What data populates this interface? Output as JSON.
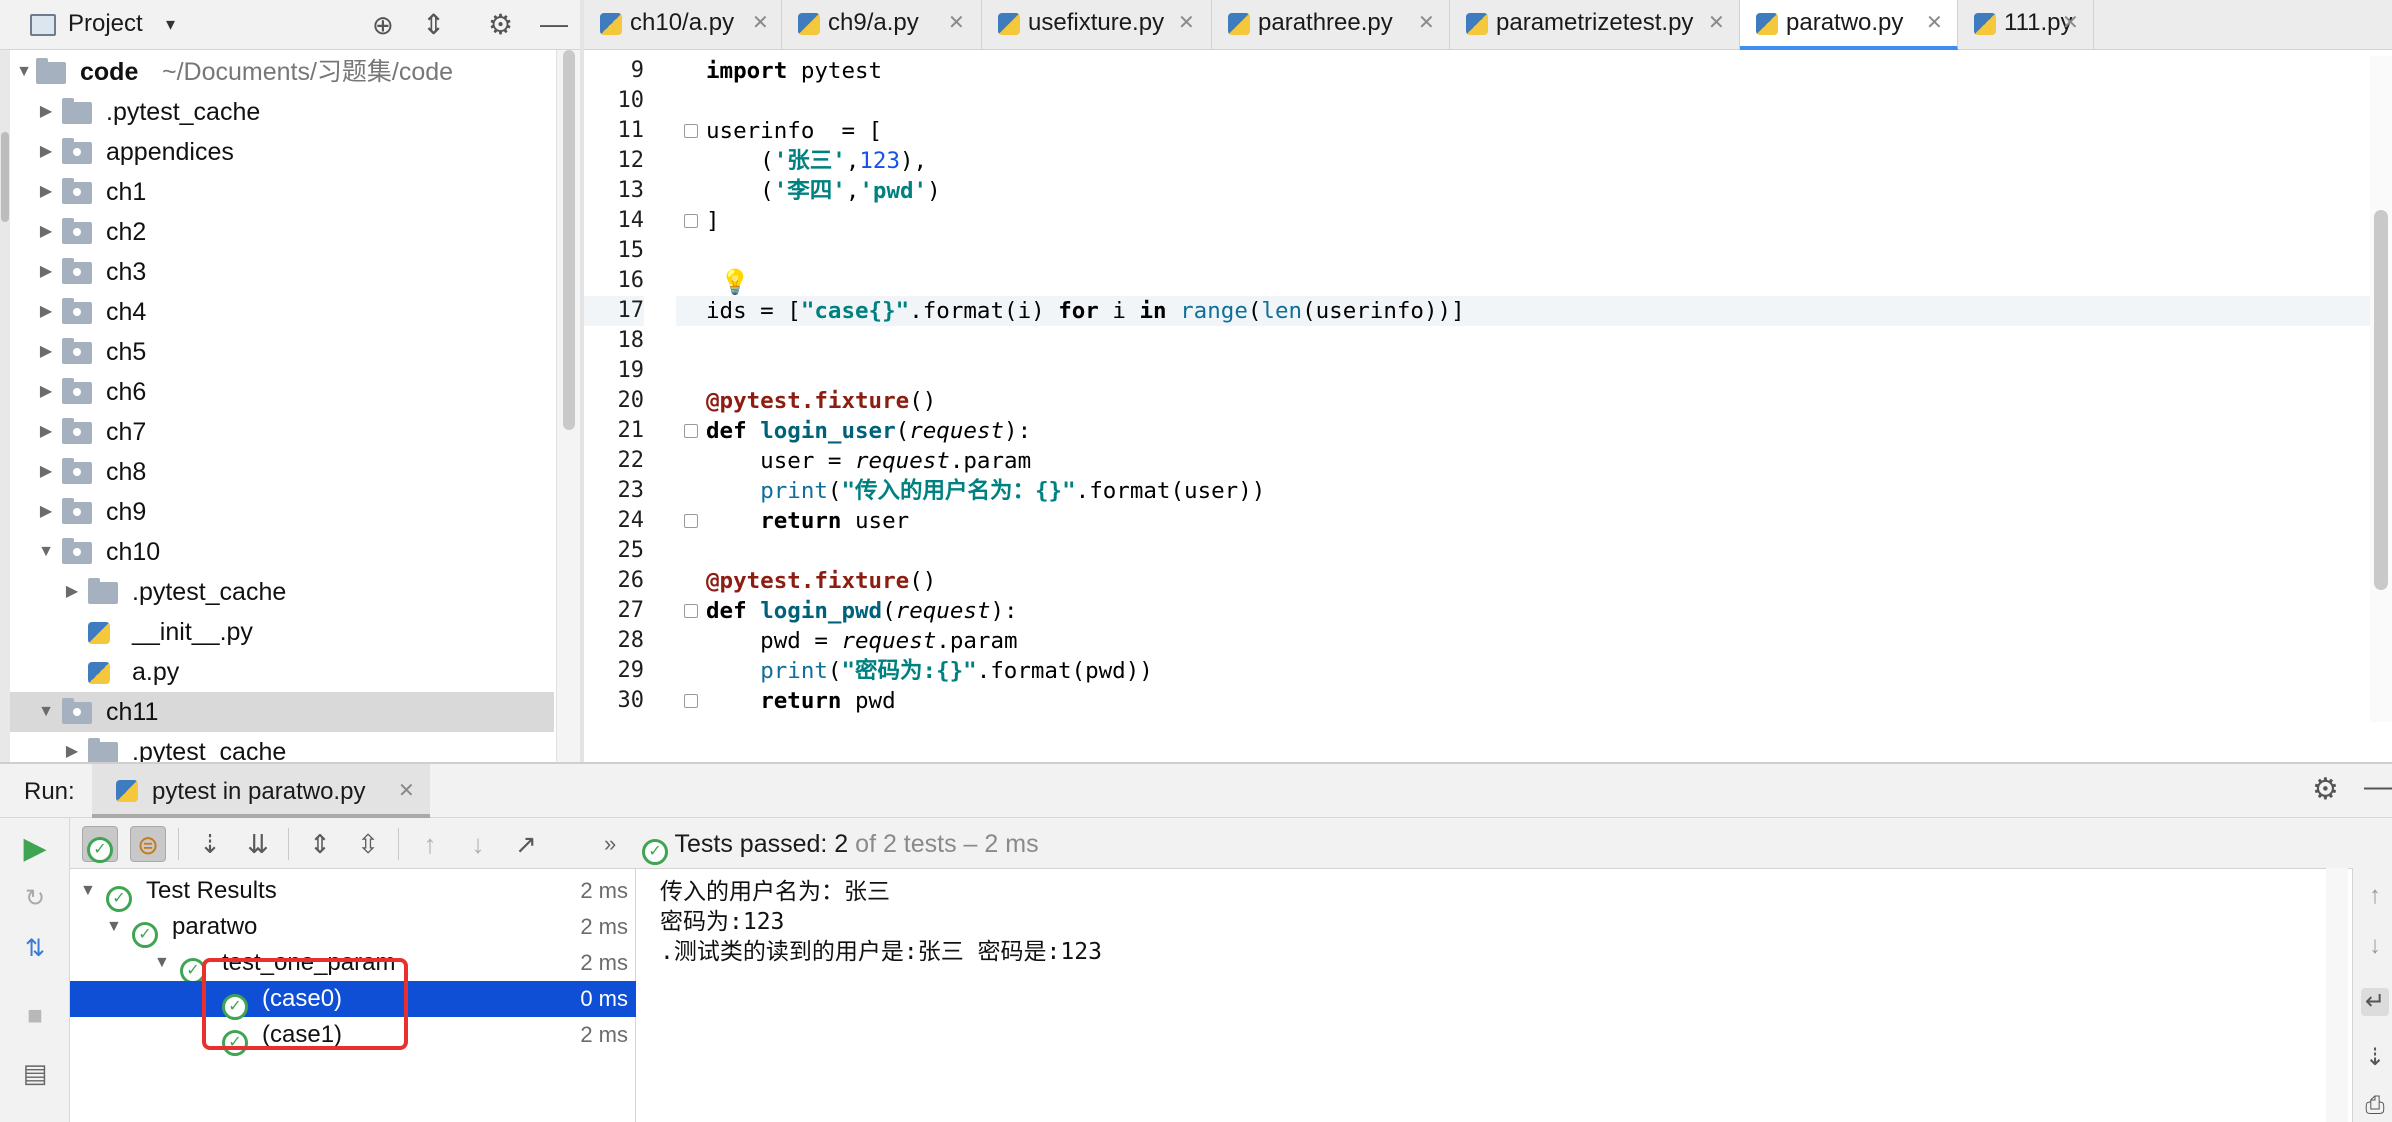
{
  "project": {
    "title": "Project",
    "root": {
      "name": "code",
      "path": "~/Documents/习题集/code"
    },
    "items": [
      {
        "label": ".pytest_cache",
        "type": "folder",
        "depth": 1,
        "expanded": false
      },
      {
        "label": "appendices",
        "type": "package",
        "depth": 1,
        "expanded": false
      },
      {
        "label": "ch1",
        "type": "package",
        "depth": 1,
        "expanded": false
      },
      {
        "label": "ch2",
        "type": "package",
        "depth": 1,
        "expanded": false
      },
      {
        "label": "ch3",
        "type": "package",
        "depth": 1,
        "expanded": false
      },
      {
        "label": "ch4",
        "type": "package",
        "depth": 1,
        "expanded": false
      },
      {
        "label": "ch5",
        "type": "package",
        "depth": 1,
        "expanded": false
      },
      {
        "label": "ch6",
        "type": "package",
        "depth": 1,
        "expanded": false
      },
      {
        "label": "ch7",
        "type": "package",
        "depth": 1,
        "expanded": false
      },
      {
        "label": "ch8",
        "type": "package",
        "depth": 1,
        "expanded": false
      },
      {
        "label": "ch9",
        "type": "package",
        "depth": 1,
        "expanded": false
      },
      {
        "label": "ch10",
        "type": "package",
        "depth": 1,
        "expanded": true
      },
      {
        "label": ".pytest_cache",
        "type": "folder",
        "depth": 2,
        "expanded": false
      },
      {
        "label": "__init__.py",
        "type": "python",
        "depth": 2
      },
      {
        "label": "a.py",
        "type": "python",
        "depth": 2
      },
      {
        "label": "ch11",
        "type": "package",
        "depth": 1,
        "expanded": true,
        "selected": true
      },
      {
        "label": ".pytest_cache",
        "type": "folder",
        "depth": 2,
        "expanded": false
      }
    ]
  },
  "tabs": [
    {
      "label": "ch10/a.py"
    },
    {
      "label": "ch9/a.py"
    },
    {
      "label": "usefixture.py"
    },
    {
      "label": "parathree.py"
    },
    {
      "label": "parametrizetest.py"
    },
    {
      "label": "paratwo.py",
      "active": true
    },
    {
      "label": "111.py"
    }
  ],
  "editor": {
    "line_numbers": [
      "9",
      "10",
      "11",
      "12",
      "13",
      "14",
      "15",
      "16",
      "17",
      "18",
      "19",
      "20",
      "21",
      "22",
      "23",
      "24",
      "25",
      "26",
      "27",
      "28",
      "29",
      "30"
    ],
    "highlighted_line": "17",
    "code": {
      "l9_kw": "import",
      "l9_rest": " pytest",
      "l11": "userinfo  = [",
      "l12_a": "    (",
      "l12_s": "'张三'",
      "l12_b": ",",
      "l12_n": "123",
      "l12_c": "),",
      "l13_a": "    (",
      "l13_s1": "'李四'",
      "l13_b": ",",
      "l13_s2": "'pwd'",
      "l13_c": ")",
      "l14": "]",
      "l17_a": "ids = [",
      "l17_s": "\"case{}\"",
      "l17_b": ".format(i) ",
      "l17_for": "for",
      "l17_c": " i ",
      "l17_in": "in",
      "l17_d": " ",
      "l17_range": "range",
      "l17_e": "(",
      "l17_len": "len",
      "l17_f": "(userinfo))]",
      "l20_dec": "@pytest.fixture",
      "l20_rest": "()",
      "l21_def": "def",
      "l21_sp": " ",
      "l21_fn": "login_user",
      "l21_a": "(",
      "l21_param": "request",
      "l21_b": "):",
      "l22_a": "    user = ",
      "l22_it": "request",
      "l22_b": ".param",
      "l23_a": "    ",
      "l23_print": "print",
      "l23_b": "(",
      "l23_s": "\"传入的用户名为：{}\"",
      "l23_c": ".format(user))",
      "l24_a": "    ",
      "l24_ret": "return",
      "l24_b": " user",
      "l26_dec": "@pytest.fixture",
      "l26_rest": "()",
      "l27_def": "def",
      "l27_sp": " ",
      "l27_fn": "login_pwd",
      "l27_a": "(",
      "l27_param": "request",
      "l27_b": "):",
      "l28_a": "    pwd = ",
      "l28_it": "request",
      "l28_b": ".param",
      "l29_a": "    ",
      "l29_print": "print",
      "l29_b": "(",
      "l29_s": "\"密码为:{}\"",
      "l29_c": ".format(pwd))",
      "l30_a": "    ",
      "l30_ret": "return",
      "l30_b": " pwd"
    }
  },
  "run": {
    "label": "Run:",
    "tab_label": "pytest in paratwo.py",
    "status_passed": "Tests passed: 2",
    "status_rest": " of 2 tests – 2 ms",
    "results": [
      {
        "label": "Test Results",
        "time": "2 ms",
        "depth": 0
      },
      {
        "label": "paratwo",
        "time": "2 ms",
        "depth": 1
      },
      {
        "label": "test_one_param",
        "time": "2 ms",
        "depth": 2
      },
      {
        "label": "(case0)",
        "time": "0 ms",
        "depth": 3,
        "selected": true
      },
      {
        "label": "(case1)",
        "time": "2 ms",
        "depth": 3
      }
    ],
    "console": [
      "传入的用户名为：张三",
      "密码为:123",
      ".测试类的读到的用户是:张三 密码是:123"
    ]
  },
  "colors": {
    "accent": "#3d8ef0",
    "selection": "#0f4fd6",
    "pass": "#3fa552",
    "highlight_box": "#e8312f"
  }
}
